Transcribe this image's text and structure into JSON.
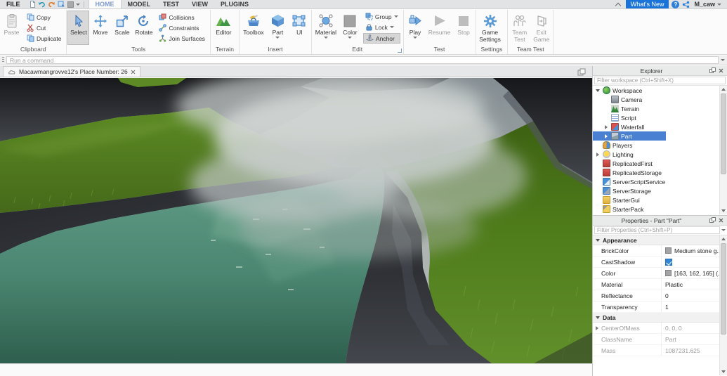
{
  "titlebar": {
    "file_menu": "FILE",
    "tabs": [
      "HOME",
      "MODEL",
      "TEST",
      "VIEW",
      "PLUGINS"
    ],
    "whats_new": "What's New",
    "help": "?",
    "username": "M_caw"
  },
  "ribbon": {
    "clipboard": {
      "label": "Clipboard",
      "paste": "Paste",
      "copy": "Copy",
      "cut": "Cut",
      "duplicate": "Duplicate"
    },
    "tools": {
      "label": "Tools",
      "select": "Select",
      "move": "Move",
      "scale": "Scale",
      "rotate": "Rotate",
      "collisions": "Collisions",
      "constraints": "Constraints",
      "join_surfaces": "Join Surfaces"
    },
    "terrain": {
      "label": "Terrain",
      "editor": "Editor"
    },
    "insert": {
      "label": "Insert",
      "toolbox": "Toolbox",
      "part": "Part",
      "ui": "UI"
    },
    "edit": {
      "label": "Edit",
      "material": "Material",
      "color": "Color",
      "group": "Group",
      "lock": "Lock",
      "anchor": "Anchor"
    },
    "test": {
      "label": "Test",
      "play": "Play",
      "resume": "Resume",
      "stop": "Stop"
    },
    "settings": {
      "label": "Settings",
      "game_settings_line1": "Game",
      "game_settings_line2": "Settings"
    },
    "team_test": {
      "label": "Team Test",
      "team_line1": "Team",
      "team_line2": "Test",
      "exit_line1": "Exit",
      "exit_line2": "Game"
    }
  },
  "command_bar": {
    "placeholder": "Run a command"
  },
  "document_tab": {
    "title": "Macawmangrovve12's Place Number: 26"
  },
  "explorer": {
    "title": "Explorer",
    "filter_placeholder": "Filter workspace (Ctrl+Shift+X)",
    "items": [
      {
        "label": "Workspace"
      },
      {
        "label": "Camera"
      },
      {
        "label": "Terrain"
      },
      {
        "label": "Script"
      },
      {
        "label": "Waterfall"
      },
      {
        "label": "Part"
      },
      {
        "label": "Players"
      },
      {
        "label": "Lighting"
      },
      {
        "label": "ReplicatedFirst"
      },
      {
        "label": "ReplicatedStorage"
      },
      {
        "label": "ServerScriptService"
      },
      {
        "label": "ServerStorage"
      },
      {
        "label": "StarterGui"
      },
      {
        "label": "StarterPack"
      }
    ]
  },
  "properties": {
    "title": "Properties - Part \"Part\"",
    "filter_placeholder": "Filter Properties (Ctrl+Shift+P)",
    "section_appearance": "Appearance",
    "section_data": "Data",
    "brickcolor_name": "BrickColor",
    "brickcolor_value": "Medium stone g...",
    "castshadow_name": "CastShadow",
    "color_name": "Color",
    "color_value": "[163, 162, 165] (...",
    "material_name": "Material",
    "material_value": "Plastic",
    "reflectance_name": "Reflectance",
    "reflectance_value": "0",
    "transparency_name": "Transparency",
    "transparency_value": "1",
    "centerofmass_name": "CenterOfMass",
    "centerofmass_value": "0, 0, 0",
    "classname_name": "ClassName",
    "classname_value": "Part",
    "mass_name": "Mass",
    "mass_value": "1087231.625",
    "swatch_style": "background:#a3a2a5"
  },
  "colors": {
    "accent_blue": "#2f80d8",
    "whats_new_bg": "#1a73d8",
    "tree_selection": "#4a80d1",
    "water": "#4c8a76",
    "grass": "#55821f",
    "rock": "#2b2d31"
  }
}
